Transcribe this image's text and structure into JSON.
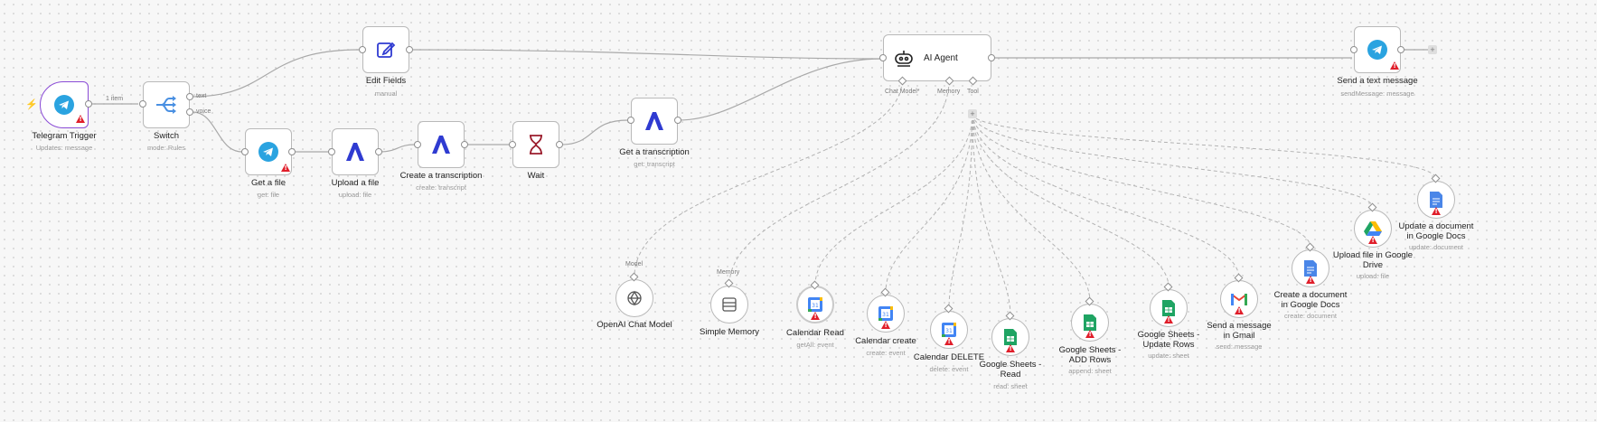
{
  "nodes": {
    "telegram_trigger": {
      "title": "Telegram Trigger",
      "subtitle": "Updates: message"
    },
    "switch": {
      "title": "Switch",
      "subtitle": "mode: Rules",
      "out1": "text",
      "out2": "voice"
    },
    "edit_fields": {
      "title": "Edit Fields",
      "subtitle": "manual"
    },
    "get_file": {
      "title": "Get a file",
      "subtitle": "get: file"
    },
    "upload_file": {
      "title": "Upload a file",
      "subtitle": "upload: file"
    },
    "create_transcription": {
      "title": "Create a transcription",
      "subtitle": "create: transcript"
    },
    "wait": {
      "title": "Wait",
      "subtitle": ""
    },
    "get_transcription": {
      "title": "Get a transcription",
      "subtitle": "get: transcript"
    },
    "ai_agent": {
      "title": "AI Agent",
      "chat_model_label": "Chat Model*",
      "memory_label": "Memory",
      "tool_label": "Tool"
    },
    "send_text": {
      "title": "Send a text message",
      "subtitle": "sendMessage: message"
    },
    "openai_chat": {
      "title": "OpenAI Chat Model",
      "subtitle": "",
      "port_label": "Model"
    },
    "simple_memory": {
      "title": "Simple Memory",
      "subtitle": "",
      "port_label": "Memory"
    },
    "calendar_read": {
      "title": "Calendar Read",
      "subtitle": "getAll: event"
    },
    "calendar_create": {
      "title": "Calendar create",
      "subtitle": "create: event"
    },
    "calendar_delete": {
      "title": "Calendar DELETE",
      "subtitle": "delete: event"
    },
    "sheets_read": {
      "title": "Google Sheets - Read",
      "subtitle": "read: sheet"
    },
    "sheets_add": {
      "title": "Google Sheets - ADD Rows",
      "subtitle": "append: sheet"
    },
    "sheets_update": {
      "title": "Google Sheets - Update Rows",
      "subtitle": "update: sheet"
    },
    "gmail_send": {
      "title": "Send a message in Gmail",
      "subtitle": "send: message"
    },
    "docs_create": {
      "title": "Create a document in Google Docs",
      "subtitle": "create: document"
    },
    "drive_upload": {
      "title": "Upload file in Google Drive",
      "subtitle": "upload: file"
    },
    "docs_update": {
      "title": "Update a document in Google Docs",
      "subtitle": "update: document"
    }
  },
  "edge_labels": {
    "trigger_to_switch": "1 item"
  },
  "colors": {
    "telegram": "#2aa3e0",
    "trigger_border": "#8a4bd6",
    "assembly": "#2f3bd1",
    "wait": "#9b1c2c",
    "warning": "#e01e2a",
    "sheets": "#1fa463",
    "docs": "#4a86e8",
    "bolt": "#f59b00"
  },
  "icons": {
    "trigger": "telegram-icon",
    "switch": "switch-branch-icon",
    "edit": "pencil-edit-icon",
    "assembly": "assemblyai-icon",
    "wait": "hourglass-icon",
    "agent": "robot-icon",
    "openai": "openai-icon",
    "memory": "database-icon",
    "calendar": "google-calendar-icon",
    "sheets": "google-sheets-icon",
    "gmail": "gmail-icon",
    "docs": "google-docs-icon",
    "drive": "google-drive-icon"
  }
}
